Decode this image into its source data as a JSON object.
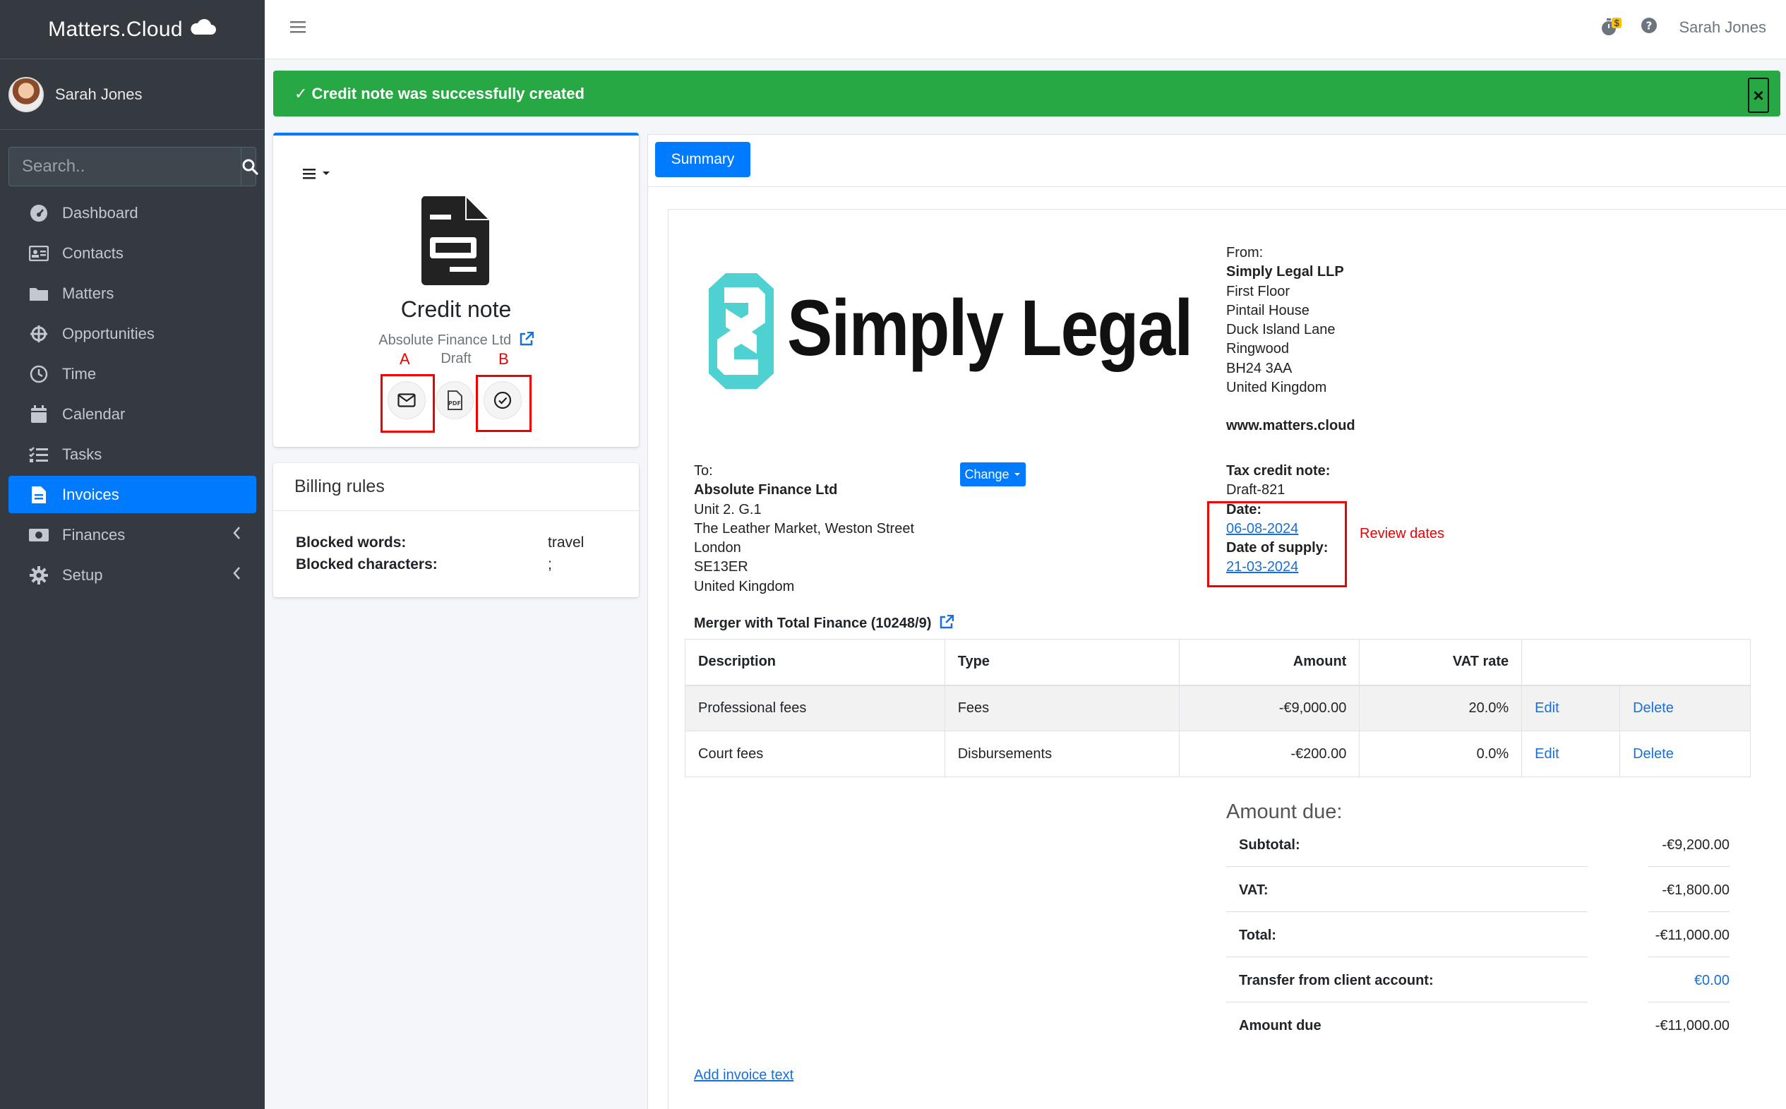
{
  "app": {
    "brand": "Matters.Cloud"
  },
  "user": {
    "name": "Sarah Jones"
  },
  "search": {
    "placeholder": "Search.."
  },
  "sidebar": {
    "items": [
      {
        "label": "Dashboard",
        "icon": "dashboard-icon"
      },
      {
        "label": "Contacts",
        "icon": "contacts-icon"
      },
      {
        "label": "Matters",
        "icon": "folder-icon"
      },
      {
        "label": "Opportunities",
        "icon": "crosshair-icon"
      },
      {
        "label": "Time",
        "icon": "clock-icon"
      },
      {
        "label": "Calendar",
        "icon": "calendar-icon"
      },
      {
        "label": "Tasks",
        "icon": "tasks-icon"
      },
      {
        "label": "Invoices",
        "icon": "invoice-icon",
        "active": true
      },
      {
        "label": "Finances",
        "icon": "money-icon"
      },
      {
        "label": "Setup",
        "icon": "gear-icon"
      }
    ]
  },
  "topbar": {
    "user": "Sarah Jones",
    "timer_badge": "$"
  },
  "alert": {
    "message": "✓ Credit note was successfully created",
    "close": "×"
  },
  "document_card": {
    "title": "Credit note",
    "client": "Absolute Finance Ltd",
    "status": "Draft",
    "annotation_a": "A",
    "annotation_b": "B"
  },
  "billing_rules": {
    "title": "Billing rules",
    "blocked_words_label": "Blocked words:",
    "blocked_words_value": "travel",
    "blocked_chars_label": "Blocked characters:",
    "blocked_chars_value": ";"
  },
  "tabs": {
    "summary": "Summary"
  },
  "invoice": {
    "logo_text": "Simply Legal",
    "from": {
      "label": "From:",
      "name": "Simply Legal LLP",
      "lines": [
        "First Floor",
        "Pintail House",
        "Duck Island Lane",
        "Ringwood",
        "BH24 3AA",
        "United Kingdom"
      ],
      "website": "www.matters.cloud"
    },
    "to": {
      "label": "To:",
      "name": "Absolute Finance Ltd",
      "lines": [
        "Unit 2. G.1",
        "The Leather Market, Weston Street",
        "London",
        "SE13ER",
        "United Kingdom"
      ],
      "change_button": "Change"
    },
    "tax_label": "Tax credit note:",
    "tax_number": "Draft-821",
    "date_label": "Date:",
    "date": "06-08-2024",
    "supply_label": "Date of supply:",
    "supply_date": "21-03-2024",
    "review_note": "Review dates",
    "matter": "Merger with Total Finance (10248/9)",
    "columns": [
      "Description",
      "Type",
      "Amount",
      "VAT rate"
    ],
    "rows": [
      {
        "description": "Professional fees",
        "type": "Fees",
        "amount": "-€9,000.00",
        "vat": "20.0%",
        "edit": "Edit",
        "delete": "Delete"
      },
      {
        "description": "Court fees",
        "type": "Disbursements",
        "amount": "-€200.00",
        "vat": "0.0%",
        "edit": "Edit",
        "delete": "Delete"
      }
    ],
    "amount_due_heading": "Amount due:",
    "totals": [
      {
        "label": "Subtotal:",
        "value": "-€9,200.00"
      },
      {
        "label": "VAT:",
        "value": "-€1,800.00"
      },
      {
        "label": "Total:",
        "value": "-€11,000.00"
      },
      {
        "label": "Transfer from client account:",
        "value": "€0.00",
        "link": true
      },
      {
        "label": "Amount due",
        "value": "-€11,000.00"
      }
    ],
    "add_text_link": "Add invoice text"
  },
  "colors": {
    "sidebar": "#343a40",
    "primary": "#007bff",
    "success": "#28a745",
    "annotation": "#ee0000"
  }
}
